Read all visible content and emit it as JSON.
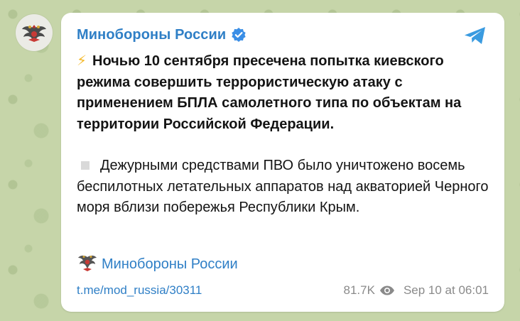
{
  "channel": {
    "name": "Минобороны России",
    "verified_icon": "verified-badge-icon",
    "avatar_icon": "emblem-icon",
    "share_icon": "telegram-share-icon"
  },
  "post": {
    "bolt_emoji": "⚡",
    "headline": "Ночью 10 сентября пресечена попытка киевского режима совершить террористическую атаку с применением БПЛА самолетного типа по объектам на территории Российской Федерации.",
    "body": "Дежурными средствами ПВО было уничтожено восемь беспилотных летательных аппаратов над акваторией Черного моря вблизи побережья Республики Крым.",
    "signature_link": "Минобороны России"
  },
  "footer": {
    "link": "t.me/mod_russia/30311",
    "views": "81.7K",
    "date": "Sep 10 at 06:01"
  },
  "colors": {
    "accent": "#2f7fc6",
    "bolt": "#f4b92a",
    "meta_text": "#8a8a8a",
    "background": "#c6d5a9"
  }
}
